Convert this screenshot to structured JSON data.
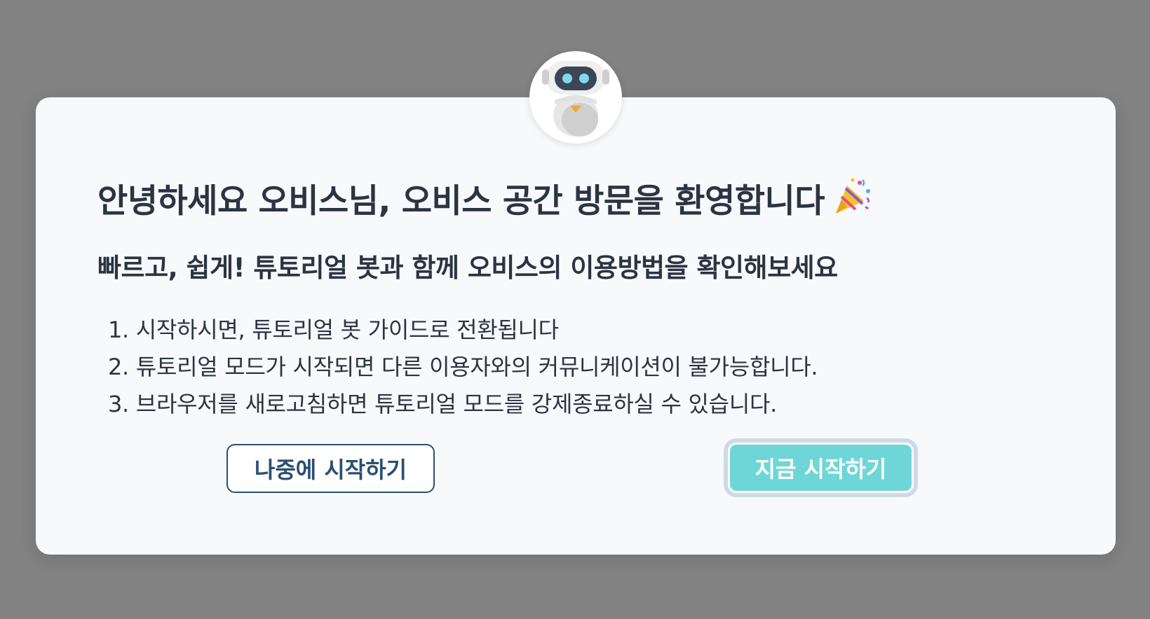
{
  "dialog": {
    "title": "안녕하세요 오비스님, 오비스 공간 방문을 환영합니다",
    "title_emoji": "party-popper-icon",
    "subtitle": "빠르고, 쉽게! 튜토리얼 봇과 함께 오비스의 이용방법을 확인해보세요",
    "steps": [
      "1. 시작하시면, 튜토리얼 봇 가이드로 전환됩니다",
      "2. 튜토리얼 모드가 시작되면  다른 이용자와의 커뮤니케이션이 불가능합니다.",
      "3. 브라우저를 새로고침하면 튜토리얼 모드를 강제종료하실 수 있습니다."
    ],
    "avatar_icon": "robot-icon"
  },
  "buttons": {
    "later_label": "나중에 시작하기",
    "start_label": "지금 시작하기"
  },
  "colors": {
    "backdrop": "#828282",
    "card": "#f7f9fb",
    "text": "#2c3443",
    "outline_button": "#2a4f72",
    "primary_button": "#6fd6d8",
    "focus_ring": "#cfd9e6"
  }
}
